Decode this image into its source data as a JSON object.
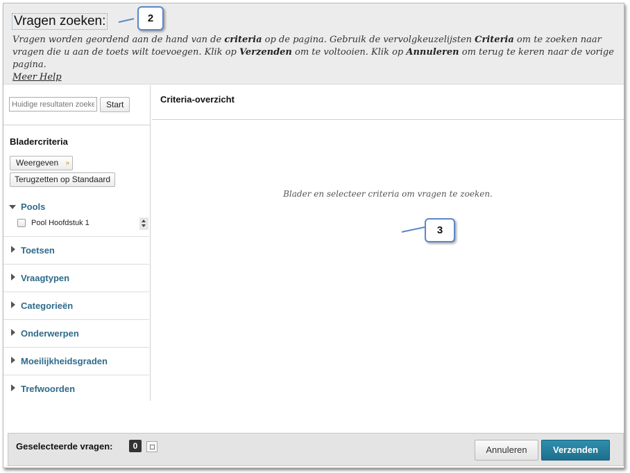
{
  "header": {
    "title": "Vragen zoeken:",
    "description_parts": [
      "Vragen worden geordend aan de hand van de ",
      "criteria",
      " op de pagina. Gebruik de vervolgkeuzelijsten ",
      "Criteria",
      " om te zoeken naar vragen die u aan de toets wilt toevoegen. Klik op ",
      "Verzenden",
      " om te voltooien. Klik op ",
      "Annuleren",
      " om terug te keren naar de vorige pagina."
    ],
    "help_link": "Meer Help"
  },
  "callouts": {
    "first": "2",
    "second": "3"
  },
  "search": {
    "placeholder": "Huidige resultaten zoeken",
    "start_label": "Start"
  },
  "browse": {
    "title": "Bladercriteria",
    "view_label": "Weergeven",
    "reset_label": "Terugzetten op Standaard",
    "pools": {
      "label": "Pools",
      "items": [
        "Pool Hoofdstuk 1"
      ]
    },
    "facets": [
      "Toetsen",
      "Vraagtypen",
      "Categorieën",
      "Onderwerpen",
      "Moeilijkheidsgraden",
      "Trefwoorden"
    ]
  },
  "main": {
    "title": "Criteria-overzicht",
    "empty_message": "Blader en selecteer criteria om vragen te zoeken."
  },
  "footer": {
    "selected_label": "Geselecteerde vragen:",
    "selected_count": "0",
    "cancel_label": "Annuleren",
    "submit_label": "Verzenden"
  },
  "colors": {
    "header_bg": "#ececec",
    "facet_label": "#2d6b8b",
    "submit_bg": "#1d6f8c",
    "callout_border": "#5b87c9"
  }
}
